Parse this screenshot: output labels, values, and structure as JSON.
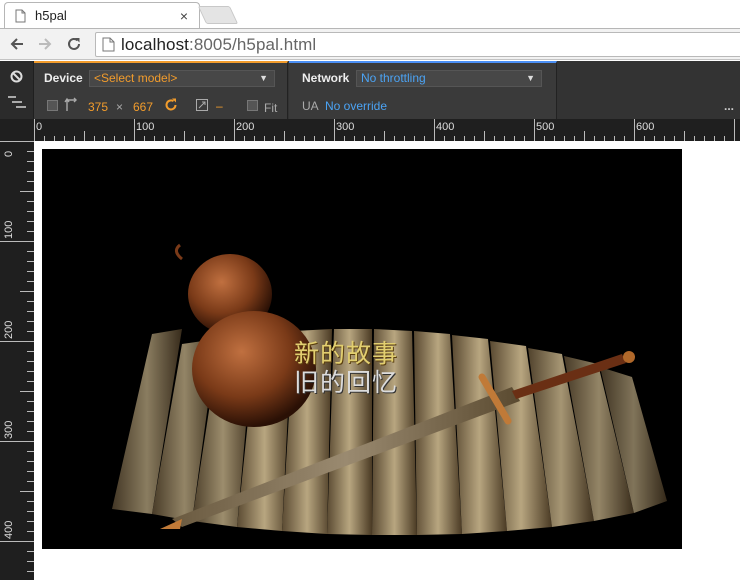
{
  "browser": {
    "tab_title": "h5pal",
    "close_glyph": "×",
    "url_host": "localhost",
    "url_rest": ":8005/h5pal.html"
  },
  "devtools": {
    "device_label": "Device",
    "device_select": "<Select model>",
    "width": "375",
    "times": "×",
    "height": "667",
    "zoom_dash": "–",
    "fit_label": "Fit",
    "network_label": "Network",
    "network_select": "No throttling",
    "ua_label": "UA",
    "ua_value": "No override",
    "more": "..."
  },
  "rulers": {
    "horizontal": [
      "0",
      "100",
      "200",
      "300",
      "400",
      "500",
      "600"
    ],
    "vertical": [
      "0",
      "100",
      "200",
      "300",
      "400"
    ]
  },
  "game": {
    "line1": "新的故事",
    "line2": "旧的回忆"
  },
  "colors": {
    "device_accent": "#f29c2c",
    "network_accent": "#4b8ff4",
    "link_blue": "#4ba3f4"
  }
}
